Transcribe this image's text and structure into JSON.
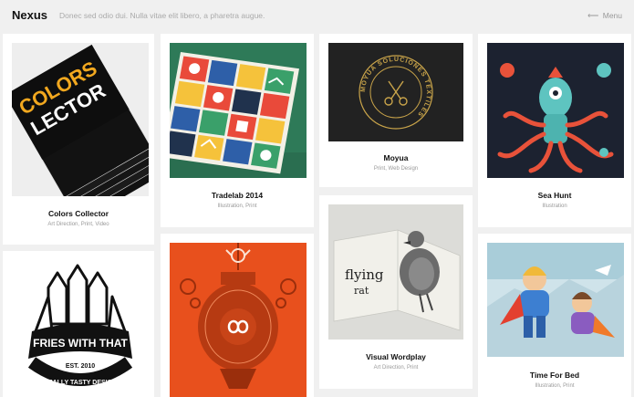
{
  "header": {
    "site_title": "Nexus",
    "tagline": "Donec sed odio dui. Nulla vitae elit libero, a pharetra augue.",
    "menu_label": "Menu",
    "menu_arrow": "⟵"
  },
  "projects": [
    {
      "title": "Colors Collector",
      "categories": "Art Direction, Print, Video",
      "cover_text": [
        "COLORS",
        "LECTOR"
      ]
    },
    {
      "title": "Tradelab 2014",
      "categories": "Illustration, Print"
    },
    {
      "title": "Moyua",
      "categories": "Print, Web Design",
      "badge_text": "MOYUA SOLUCIONES TEXTILES"
    },
    {
      "title": "Sea Hunt",
      "categories": "Illustration"
    },
    {
      "title": "Visual Wordplay",
      "categories": "Art Direction, Print",
      "book_text": [
        "flying",
        "rat"
      ]
    },
    {
      "title": "Time For Bed",
      "categories": "Illustration, Print"
    },
    {
      "title": "",
      "categories": "",
      "logo_text": [
        "FRIES WITH THAT",
        "EST. 2010",
        "REALLY TASTY DESIGN"
      ]
    },
    {
      "title": "",
      "categories": ""
    }
  ],
  "colors": {
    "page_bg": "#f0f0f0",
    "card_bg": "#ffffff",
    "accent_orange": "#e8501d",
    "dark_navy": "#1f2a3a"
  }
}
